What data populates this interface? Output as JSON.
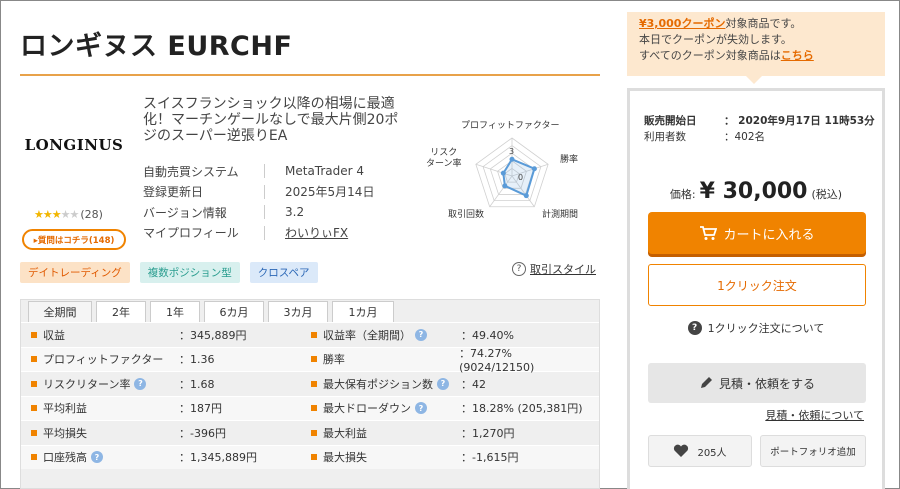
{
  "title": "ロンギヌス EURCHF",
  "product": {
    "logo_text": "LONGINUS",
    "rating_stars": 3,
    "rating_max": 5,
    "review_count": "(28)",
    "qa_button": "▸質問はコチラ(148)",
    "description": "スイスフランショック以降の相場に最適化！マーチンゲールなしで最大片側20ポジのスーパー逆張りEA",
    "info": [
      {
        "key": "自動売買システム",
        "value": "MetaTrader 4",
        "link": false
      },
      {
        "key": "登録更新日",
        "value": "2025年5月14日",
        "link": false
      },
      {
        "key": "バージョン情報",
        "value": "3.2",
        "link": false
      },
      {
        "key": "マイプロフィール",
        "value": "わいりぃFX",
        "link": true
      }
    ]
  },
  "radar": {
    "labels": [
      "プロフィットファクター",
      "勝率",
      "計測期間",
      "取引回数",
      "リスク\nターン率"
    ],
    "scale_labels": [
      "3",
      "0"
    ],
    "values": [
      2.2,
      3.1,
      3.2,
      1.6,
      1.2
    ],
    "max": 5,
    "color": "#5a9bd8"
  },
  "tags": [
    {
      "label": "デイトレーディング",
      "style": "orange"
    },
    {
      "label": "複数ポジション型",
      "style": "green"
    },
    {
      "label": "クロスペア",
      "style": "blue"
    }
  ],
  "trade_style_link": "取引スタイル",
  "tabs": [
    "全期間",
    "2年",
    "1年",
    "6カ月",
    "3カ月",
    "1カ月"
  ],
  "active_tab": 0,
  "stats": [
    {
      "l_label": "収益",
      "l_hint": false,
      "l_value": "：345,889円",
      "r_label": "収益率（全期間）",
      "r_hint": true,
      "r_value": "：49.40%"
    },
    {
      "l_label": "プロフィットファクター",
      "l_hint": false,
      "l_value": "：1.36",
      "r_label": "勝率",
      "r_hint": false,
      "r_value": "：74.27% (9024/12150)"
    },
    {
      "l_label": "リスクリターン率",
      "l_hint": true,
      "l_value": "：1.68",
      "r_label": "最大保有ポジション数",
      "r_hint": true,
      "r_value": "：42"
    },
    {
      "l_label": "平均利益",
      "l_hint": false,
      "l_value": "：187円",
      "r_label": "最大ドローダウン",
      "r_hint": true,
      "r_value": "：18.28% (205,381円)"
    },
    {
      "l_label": "平均損失",
      "l_hint": false,
      "l_value": "：-396円",
      "r_label": "最大利益",
      "r_hint": false,
      "r_value": "：1,270円"
    },
    {
      "l_label": "口座残高",
      "l_hint": true,
      "l_value": "：1,345,889円",
      "r_label": "最大損失",
      "r_hint": false,
      "r_value": "：-1,615円"
    }
  ],
  "coupon": {
    "amount_link": "¥3,000クーポン",
    "line1_rest": "対象商品です。",
    "line2": "本日でクーポンが失効します。",
    "line3_pre": "すべてのクーポン対象商品は",
    "line3_link": "こちら"
  },
  "purchase": {
    "sale_start_label": "販売開始日",
    "sale_start_value": "：  2020年9月17日 11時53分",
    "users_label": "利用者数",
    "users_value": "：402名",
    "price_label": "価格:",
    "price": "¥ 30,000",
    "tax": "(税込)",
    "cart_button": "カートに入れる",
    "oneclick_button": "1クリック注文",
    "oneclick_about": "1クリック注文について",
    "estimate_button": "見積・依頼をする",
    "estimate_about": "見積・依頼について",
    "favorite_count": "205人",
    "portfolio_button": "ポートフォリオ追加"
  },
  "colors": {
    "accent": "#f08300",
    "rule": "#e8a24a",
    "chart": "#5a9bd8"
  }
}
